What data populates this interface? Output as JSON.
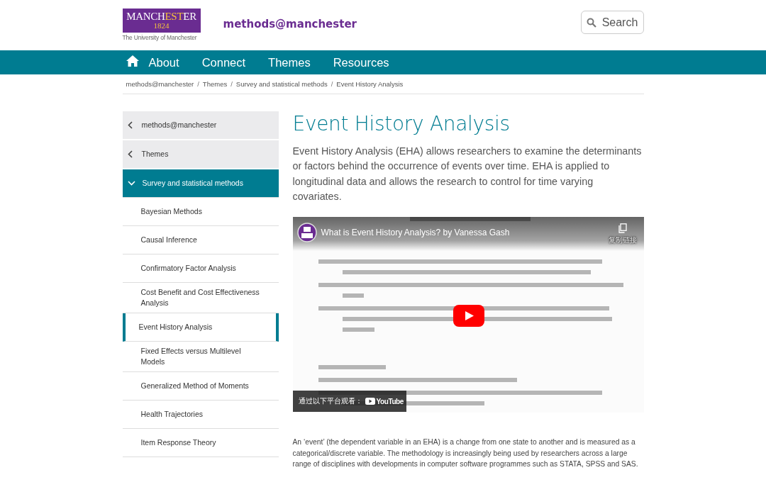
{
  "header": {
    "logo": {
      "parts": [
        {
          "text": "MANCH",
          "accent": false
        },
        {
          "text": "EST",
          "accent": true
        },
        {
          "text": "ER",
          "accent": false
        }
      ],
      "year": "1824",
      "caption": "The University of Manchester"
    },
    "site_name": "methods@manchester",
    "search": {
      "label": "Search"
    }
  },
  "nav": {
    "items": [
      {
        "label": "About"
      },
      {
        "label": "Connect"
      },
      {
        "label": "Themes"
      },
      {
        "label": "Resources"
      }
    ]
  },
  "breadcrumb": [
    {
      "label": "methods@manchester"
    },
    {
      "separator": "/",
      "label": "Themes"
    },
    {
      "separator": "/",
      "label": "Survey and statistical methods"
    },
    {
      "separator": "/",
      "label": "Event History Analysis"
    }
  ],
  "sidebar": {
    "items": [
      {
        "label": "methods@manchester",
        "kind": "parent",
        "selected": false
      },
      {
        "label": "Themes",
        "kind": "parent",
        "selected": false
      },
      {
        "label": "Survey and statistical methods",
        "kind": "section",
        "selected": false
      },
      {
        "label": "Bayesian Methods",
        "kind": "child",
        "selected": false
      },
      {
        "label": "Causal Inference",
        "kind": "child",
        "selected": false
      },
      {
        "label": "Confirmatory Factor Analysis",
        "kind": "child",
        "selected": false
      },
      {
        "label": "Cost Benefit and Cost Effectiveness Analysis",
        "kind": "child",
        "selected": false
      },
      {
        "label": "Event History Analysis",
        "kind": "child",
        "selected": true
      },
      {
        "label": "Fixed Effects versus Multilevel Models",
        "kind": "child",
        "selected": false
      },
      {
        "label": "Generalized Method of Moments",
        "kind": "child",
        "selected": false
      },
      {
        "label": "Health Trajectories",
        "kind": "child",
        "selected": false
      },
      {
        "label": "Item Response Theory",
        "kind": "child",
        "selected": false
      }
    ]
  },
  "main": {
    "title": "Event History Analysis",
    "intro": "Event History Analysis (EHA) allows researchers to examine the determinants or factors behind the occurrence of events over time. EHA is applied to longitudinal data and allows the research to control for time varying covariates.",
    "video": {
      "title": "What is Event History Analysis? by Vanessa Gash",
      "copy_label": "复制链接",
      "watch_on": "通过以下平台观看：",
      "platform": "YouTube"
    },
    "body": "An ‘event’ (the dependent variable in an EHA) is a change from one state to another and is measured as a categorical/discrete variable. The methodology is increasingly being used by researchers across a large range of disciplines with developments in computer software programmes such as STATA, SPSS and SAS."
  }
}
